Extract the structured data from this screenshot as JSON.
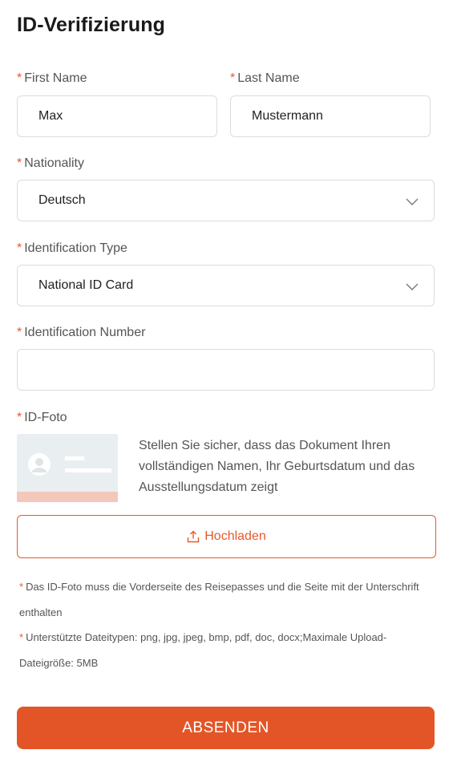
{
  "page": {
    "title": "ID-Verifizierung"
  },
  "form": {
    "required_marker": "*",
    "first_name": {
      "label": "First Name",
      "value": "Max"
    },
    "last_name": {
      "label": "Last Name",
      "value": "Mustermann"
    },
    "nationality": {
      "label": "Nationality",
      "selected": "Deutsch"
    },
    "identification_type": {
      "label": "Identification Type",
      "selected": "National ID Card"
    },
    "identification_number": {
      "label": "Identification Number",
      "value": ""
    },
    "id_photo": {
      "label": "ID-Foto",
      "description": "Stellen Sie sicher, dass das Dokument Ihren vollständigen Namen, Ihr Geburtsdatum und das Ausstellungsdatum zeigt",
      "upload_label": "Hochladen"
    },
    "notes": [
      "Das ID-Foto muss die Vorderseite des Reisepasses und die Seite mit der Unterschrift enthalten",
      "Unterstützte Dateitypen: png, jpg, jpeg, bmp, pdf, doc, docx;Maximale Upload-Dateigröße: 5MB"
    ],
    "submit_label": "ABSENDEN"
  },
  "icons": {
    "chevron": "chevron-down-icon",
    "upload": "upload-icon",
    "id_card": "id-card-placeholder-icon"
  },
  "colors": {
    "accent": "#e8582a",
    "submit_bg": "#e35527",
    "border": "#dcdcdc",
    "text": "#333333"
  }
}
